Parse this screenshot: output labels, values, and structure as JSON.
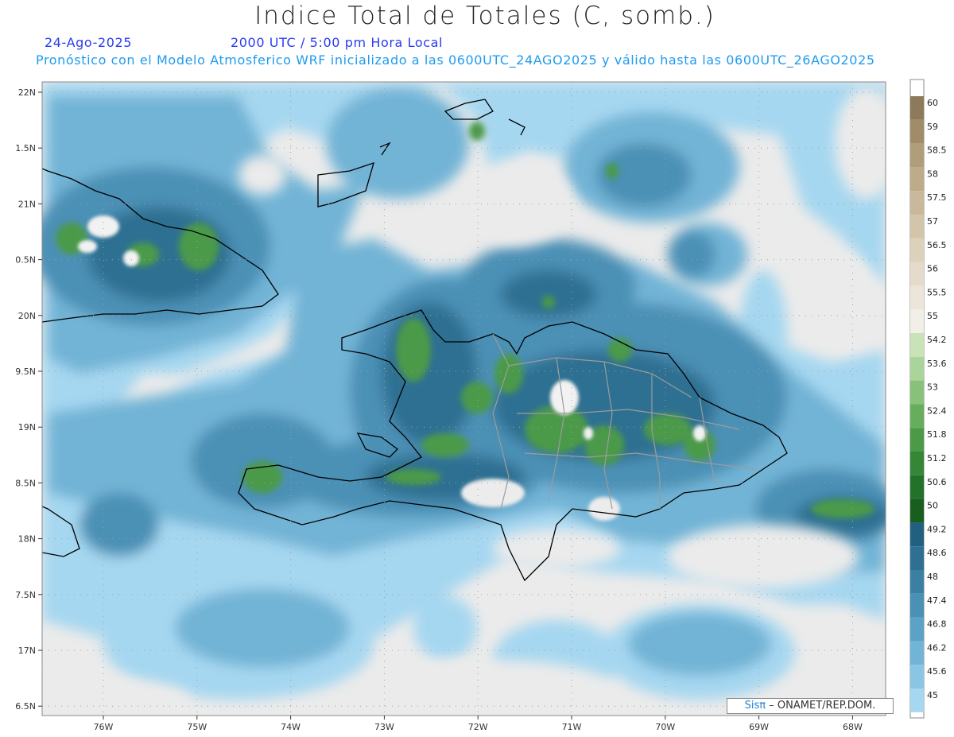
{
  "header": {
    "title": "Indice Total de Totales (C, somb.)",
    "date": "24-Ago-2025",
    "time": "2000 UTC / 5:00 pm Hora Local",
    "subtitle": "Pronóstico con el Modelo Atmosferico WRF inicializado a las 0600UTC_24AGO2025 y válido hasta las  0600UTC_26AGO2025"
  },
  "map": {
    "lat_labels": [
      "22N",
      "1.5N",
      "21N",
      "0.5N",
      "20N",
      "9.5N",
      "19N",
      "8.5N",
      "18N",
      "7.5N",
      "17N",
      "6.5N"
    ],
    "lon_labels": [
      "76W",
      "75W",
      "74W",
      "73W",
      "72W",
      "71W",
      "70W",
      "69W",
      "68W"
    ],
    "background_color": "#ebebeb"
  },
  "colorbar": {
    "labels": [
      "60",
      "59",
      "58.5",
      "58",
      "57.5",
      "57",
      "56.5",
      "56",
      "55.5",
      "55",
      "54.2",
      "53.6",
      "53",
      "52.4",
      "51.8",
      "51.2",
      "50.6",
      "50",
      "49.2",
      "48.6",
      "48",
      "47.4",
      "46.8",
      "46.2",
      "45.6",
      "45"
    ],
    "colors": [
      "#8d7a5a",
      "#a08d68",
      "#b09d79",
      "#bdab89",
      "#c9b99a",
      "#d3c5aa",
      "#dcd1bb",
      "#e4dbcb",
      "#ece6da",
      "#f2efe8",
      "#c8e3b8",
      "#a9d49a",
      "#88c27a",
      "#66ae5c",
      "#4c9a48",
      "#358637",
      "#237229",
      "#1a5e1f",
      "#21607f",
      "#2e6f92",
      "#3b80a3",
      "#4b90b5",
      "#5ca2c6",
      "#72b4d6",
      "#8ac6e4",
      "#a6d7f0"
    ]
  },
  "credit": {
    "brand": "Sisπ",
    "text": "– ONAMET/REP.DOM."
  }
}
